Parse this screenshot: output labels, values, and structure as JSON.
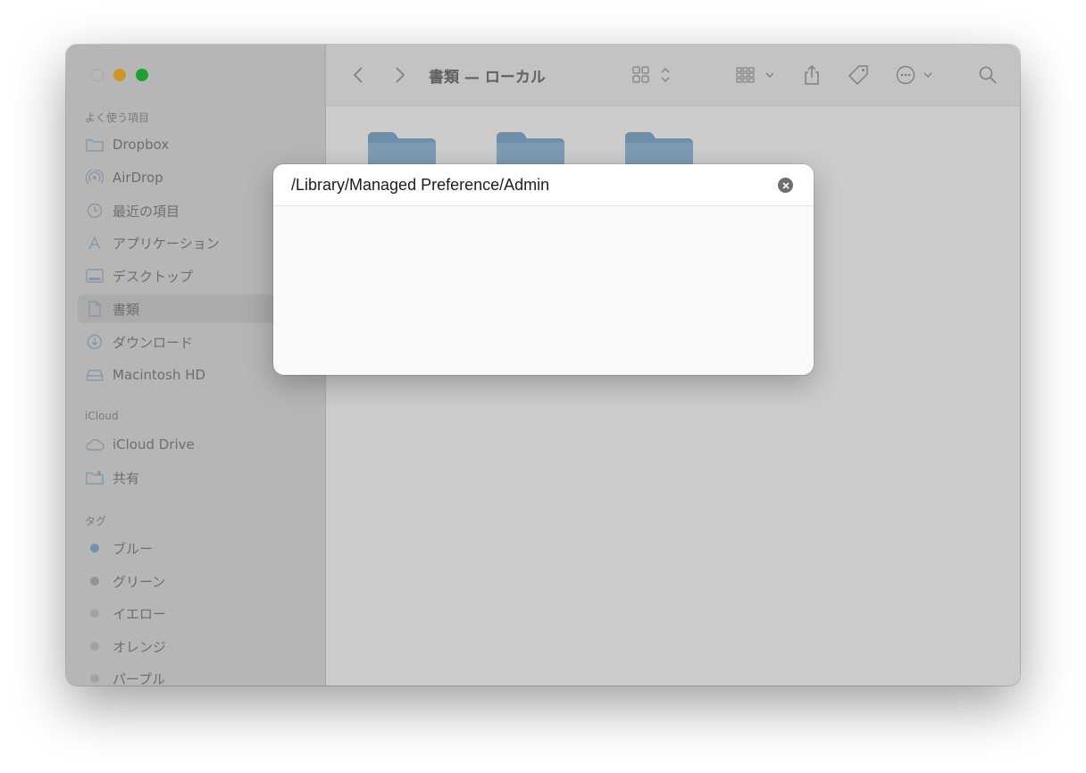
{
  "window": {
    "nav": {
      "back_icon": "chevron-left-icon",
      "forward_icon": "chevron-right-icon"
    },
    "title": "書類 — ローカル",
    "toolbar_icons": [
      "view-grid-icon",
      "group-icon",
      "share-icon",
      "tag-icon",
      "more-icon",
      "search-icon"
    ]
  },
  "sidebar": {
    "favorites_heading": "よく使う項目",
    "favorites": [
      {
        "label": "Dropbox",
        "icon": "folder-icon"
      },
      {
        "label": "AirDrop",
        "icon": "airdrop-icon"
      },
      {
        "label": "最近の項目",
        "icon": "clock-icon"
      },
      {
        "label": "アプリケーション",
        "icon": "applications-icon"
      },
      {
        "label": "デスクトップ",
        "icon": "desktop-icon"
      },
      {
        "label": "書類",
        "icon": "document-icon",
        "selected": true
      },
      {
        "label": "ダウンロード",
        "icon": "download-icon"
      },
      {
        "label": "Macintosh HD",
        "icon": "disk-icon"
      }
    ],
    "icloud_heading": "iCloud",
    "icloud": [
      {
        "label": "iCloud Drive",
        "icon": "cloud-icon"
      },
      {
        "label": "共有",
        "icon": "shared-folder-icon"
      }
    ],
    "tags_heading": "タグ",
    "tags": [
      {
        "label": "ブルー",
        "color": "#5aa7f0"
      },
      {
        "label": "グリーン",
        "color": "#b5b5b5"
      },
      {
        "label": "イエロー",
        "color": "#c9c9c9"
      },
      {
        "label": "オレンジ",
        "color": "#c9c9c9"
      },
      {
        "label": "パープル",
        "color": "#c9c9c9"
      }
    ]
  },
  "content": {
    "folders": [
      {
        "icon": "folder-icon"
      },
      {
        "icon": "folder-icon"
      },
      {
        "icon": "folder-icon"
      }
    ]
  },
  "goto_dialog": {
    "path_value": "/Library/Managed Preference/Admin",
    "clear_icon": "clear-icon"
  },
  "colors": {
    "folder": "#8fb4d3",
    "folder_tab": "#7da6c9",
    "accent": "#5aa7f0"
  }
}
